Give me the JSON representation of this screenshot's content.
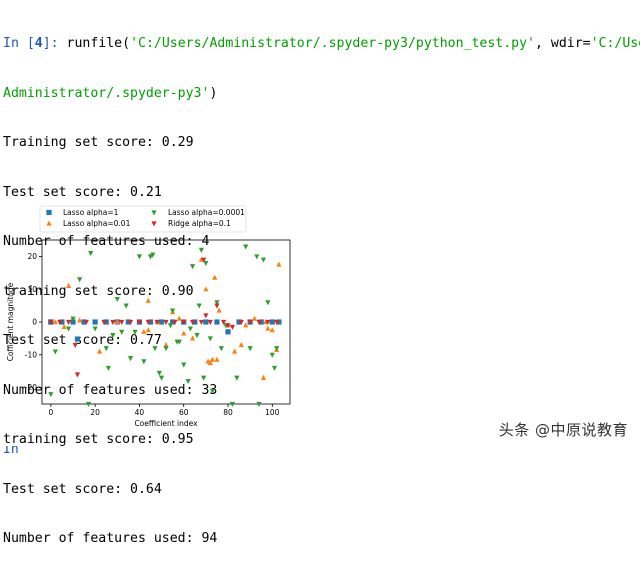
{
  "console": {
    "prompt_label": "In [",
    "prompt_number": "4",
    "prompt_close": "]: ",
    "call_prefix": "runfile(",
    "arg1": "'C:/Users/Administrator/.spyder-py3/python_test.py'",
    "sep": ", wdir=",
    "arg2_part1": "'C:/Users/",
    "arg2_part2": "Administrator/.spyder-py3'",
    "call_suffix": ")",
    "output_lines": [
      "Training set score: 0.29",
      "Test set score: 0.21",
      "Number of features used: 4",
      "training set score: 0.90",
      "Test set score: 0.77",
      "Number of features used: 33",
      "training set score: 0.95",
      "Test set score: 0.64",
      "Number of features used: 94"
    ],
    "next_prompt_fragment": "In"
  },
  "watermark": "头条 @中原说教育",
  "chart_data": {
    "type": "scatter",
    "title": "",
    "xlabel": "Coefficient index",
    "ylabel": "Cofficient magnitude",
    "xlim": [
      -4,
      108
    ],
    "ylim": [
      -25,
      25
    ],
    "xticks": [
      0,
      20,
      40,
      60,
      80,
      100
    ],
    "yticks": [
      -20,
      -10,
      0,
      10,
      20
    ],
    "grid": false,
    "legend_placement": "top",
    "series": [
      {
        "name": "Lasso alpha=1",
        "marker": "square",
        "color": "#1f77b4",
        "points": [
          [
            0,
            0
          ],
          [
            12,
            -5.2
          ],
          [
            80,
            -3
          ],
          [
            0,
            0
          ],
          [
            5,
            0
          ],
          [
            10,
            0
          ],
          [
            15,
            0
          ],
          [
            20,
            0
          ],
          [
            25,
            0
          ],
          [
            30,
            0
          ],
          [
            35,
            0
          ],
          [
            40,
            0
          ],
          [
            45,
            0
          ],
          [
            50,
            0
          ],
          [
            55,
            0
          ],
          [
            60,
            0
          ],
          [
            65,
            0
          ],
          [
            70,
            0
          ],
          [
            75,
            0
          ],
          [
            85,
            0
          ],
          [
            90,
            0
          ],
          [
            95,
            0
          ],
          [
            100,
            0
          ],
          [
            103,
            0
          ]
        ]
      },
      {
        "name": "Lasso alpha=0.01",
        "marker": "triangle-up",
        "color": "#ff7f0e",
        "points": [
          [
            8,
            11
          ],
          [
            6,
            -1.5
          ],
          [
            13,
            0.5
          ],
          [
            22,
            -9
          ],
          [
            30,
            0
          ],
          [
            42,
            -3
          ],
          [
            44,
            6.5
          ],
          [
            52,
            -7
          ],
          [
            55,
            3
          ],
          [
            58,
            1
          ],
          [
            60,
            -3.5
          ],
          [
            64,
            -5
          ],
          [
            68,
            19
          ],
          [
            70,
            10
          ],
          [
            71,
            -12
          ],
          [
            72,
            -12.5
          ],
          [
            73,
            -11.5
          ],
          [
            74,
            13.5
          ],
          [
            75,
            -11.5
          ],
          [
            76,
            3.5
          ],
          [
            80,
            -1
          ],
          [
            83,
            -9
          ],
          [
            86,
            -7
          ],
          [
            88,
            -1
          ],
          [
            92,
            1
          ],
          [
            96,
            -17
          ],
          [
            100,
            -2.5
          ],
          [
            103,
            17.5
          ],
          [
            102,
            -8.5
          ],
          [
            97,
            0
          ],
          [
            98,
            -2
          ],
          [
            44,
            -2.5
          ],
          [
            48,
            0
          ],
          [
            2,
            0
          ]
        ]
      },
      {
        "name": "Lasso alpha=0.0001",
        "marker": "triangle-down",
        "color": "#2ca02c",
        "points": [
          [
            0,
            -22
          ],
          [
            2,
            -9
          ],
          [
            8,
            -2
          ],
          [
            10,
            1
          ],
          [
            13,
            13
          ],
          [
            17,
            -25
          ],
          [
            18,
            21
          ],
          [
            20,
            -2
          ],
          [
            25,
            -8
          ],
          [
            26,
            -14
          ],
          [
            28,
            -4
          ],
          [
            30,
            7
          ],
          [
            32,
            -3
          ],
          [
            34,
            5
          ],
          [
            36,
            -11
          ],
          [
            38,
            -3
          ],
          [
            40,
            20
          ],
          [
            42,
            -12
          ],
          [
            45,
            20
          ],
          [
            46,
            20.5
          ],
          [
            47,
            -8
          ],
          [
            49,
            -15.5
          ],
          [
            50,
            -17
          ],
          [
            52,
            -8
          ],
          [
            54,
            -1
          ],
          [
            55,
            3.5
          ],
          [
            57,
            -6
          ],
          [
            58,
            -6
          ],
          [
            60,
            -13
          ],
          [
            62,
            -18
          ],
          [
            63,
            -2
          ],
          [
            64,
            17
          ],
          [
            66,
            -4
          ],
          [
            67,
            5
          ],
          [
            68,
            22
          ],
          [
            69,
            -17
          ],
          [
            70,
            18
          ],
          [
            72,
            -5
          ],
          [
            73,
            -21
          ],
          [
            75,
            6
          ],
          [
            77,
            -8
          ],
          [
            79,
            -1
          ],
          [
            82,
            -25
          ],
          [
            84,
            -17
          ],
          [
            88,
            23
          ],
          [
            90,
            -8
          ],
          [
            93,
            20
          ],
          [
            94,
            -25
          ],
          [
            96,
            19
          ],
          [
            98,
            6
          ],
          [
            100,
            -10
          ],
          [
            102,
            -8
          ],
          [
            101,
            -14
          ]
        ]
      },
      {
        "name": "Ridge alpha=0.1",
        "marker": "triangle-down",
        "color": "#d62728",
        "points": [
          [
            11,
            -7
          ],
          [
            12,
            -16
          ],
          [
            69,
            19
          ],
          [
            70,
            2
          ],
          [
            75,
            5
          ],
          [
            80,
            -1
          ],
          [
            82,
            -1.5
          ],
          [
            0,
            0
          ],
          [
            4,
            0
          ],
          [
            8,
            0
          ],
          [
            16,
            0
          ],
          [
            24,
            0
          ],
          [
            28,
            0
          ],
          [
            32,
            0
          ],
          [
            36,
            0
          ],
          [
            40,
            0
          ],
          [
            44,
            0
          ],
          [
            48,
            0
          ],
          [
            52,
            0
          ],
          [
            56,
            0
          ],
          [
            60,
            0
          ],
          [
            64,
            0
          ],
          [
            68,
            0
          ],
          [
            72,
            0
          ],
          [
            78,
            0
          ],
          [
            86,
            0
          ],
          [
            90,
            0
          ],
          [
            94,
            0
          ],
          [
            98,
            0
          ],
          [
            102,
            0
          ]
        ]
      }
    ]
  }
}
